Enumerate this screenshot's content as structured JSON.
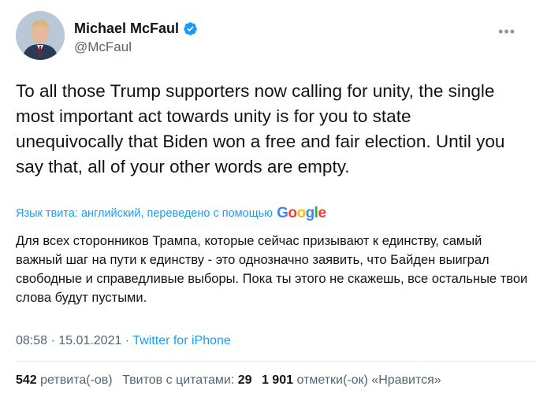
{
  "author": {
    "name": "Michael McFaul",
    "handle": "@McFaul",
    "verified": true,
    "avatar_icon": "profile-photo"
  },
  "more_icon": "ellipsis-icon",
  "tweet": {
    "text": "To all those Trump supporters now calling for unity, the single most important act towards unity is for you to state unequivocally that Biden won a free and fair election. Until you say that, all of your other words are empty."
  },
  "translation": {
    "label": "Язык твита: английский, переведено с помощью",
    "provider": "Google",
    "text": "Для всех сторонников Трампа, которые сейчас призывают к единству, самый важный шаг на пути к единству - это однозначно заявить, что Байден выиграл свободные и справедливые выборы. Пока ты этого не скажешь, все остальные твои слова будут пустыми."
  },
  "meta": {
    "time": "08:58",
    "date": "15.01.2021",
    "separator": "·",
    "source": "Twitter for iPhone"
  },
  "stats": {
    "retweets_count": "542",
    "retweets_label": "ретвита(-ов)",
    "quotes_label": "Твитов с цитатами:",
    "quotes_count": "29",
    "likes_count": "1 901",
    "likes_label": "отметки(-ок) «Нравится»"
  },
  "colors": {
    "accent": "#1d9bf0",
    "text": "#0f1419",
    "secondary": "#536471"
  }
}
